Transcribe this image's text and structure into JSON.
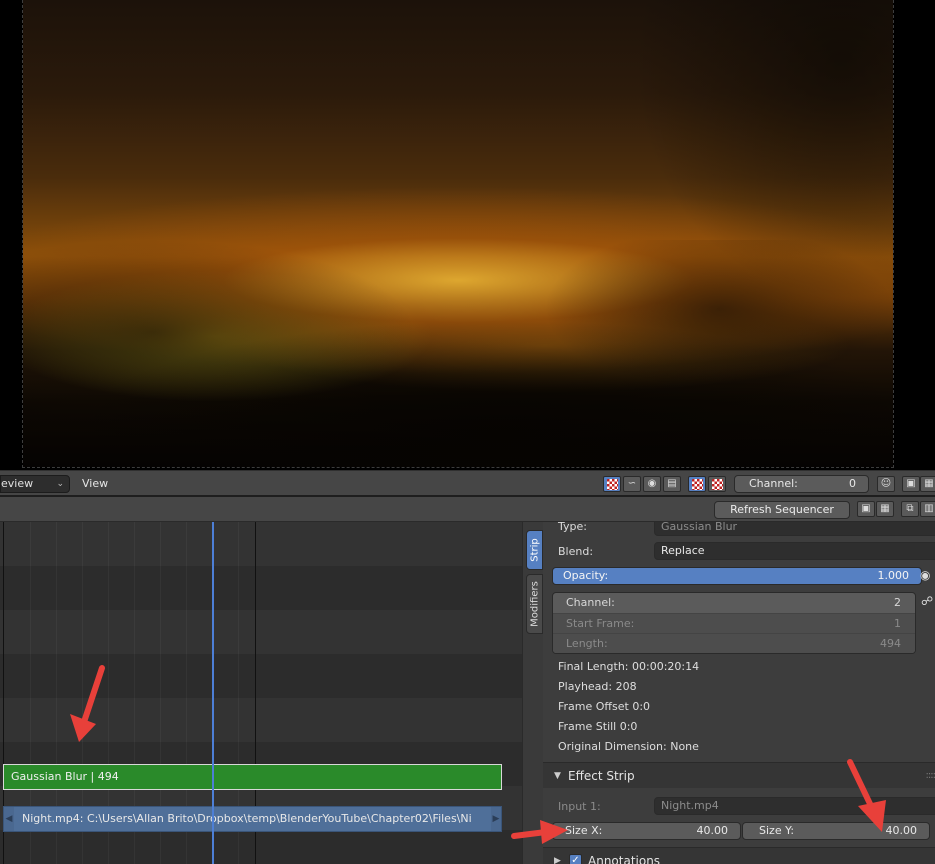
{
  "preview_header": {
    "mode_dropdown": "eview",
    "view_menu": "View",
    "channel_label": "Channel:",
    "channel_value": "0"
  },
  "sequencer_header": {
    "refresh_label": "Refresh Sequencer"
  },
  "side_tabs": {
    "strip": "Strip",
    "modifiers": "Modifiers"
  },
  "timeline": {
    "strips": [
      {
        "label": "Gaussian Blur | 494",
        "color": "#2a8a2a"
      },
      {
        "label": "Night.mp4:  C:\\Users\\Allan Brito\\Dropbox\\temp\\BlenderYouTube\\Chapter02\\Files\\Ni",
        "color": "#4f6f99"
      }
    ],
    "playhead_color": "#4d7fd6"
  },
  "properties": {
    "type_label": "Type:",
    "type_value": "Gaussian Blur",
    "blend_label": "Blend:",
    "blend_value": "Replace",
    "opacity_label": "Opacity:",
    "opacity_value": "1.000",
    "channel_label": "Channel:",
    "channel_value": "2",
    "start_frame_label": "Start Frame:",
    "start_frame_value": "1",
    "length_label": "Length:",
    "length_value": "494",
    "final_length": "Final Length: 00:00:20:14",
    "playhead": "Playhead: 208",
    "frame_offset": "Frame Offset 0:0",
    "frame_still": "Frame Still 0:0",
    "original_dimension": "Original Dimension: None",
    "effect_strip_title": "Effect Strip",
    "input1_label": "Input 1:",
    "input1_value": "Night.mp4",
    "size_x_label": "Size X:",
    "size_x_value": "40.00",
    "size_y_label": "Size Y:",
    "size_y_value": "40.00",
    "annotations_title": "Annotations"
  },
  "colors": {
    "accent_blue": "#5680c2",
    "annotation_red": "#e8403a"
  }
}
